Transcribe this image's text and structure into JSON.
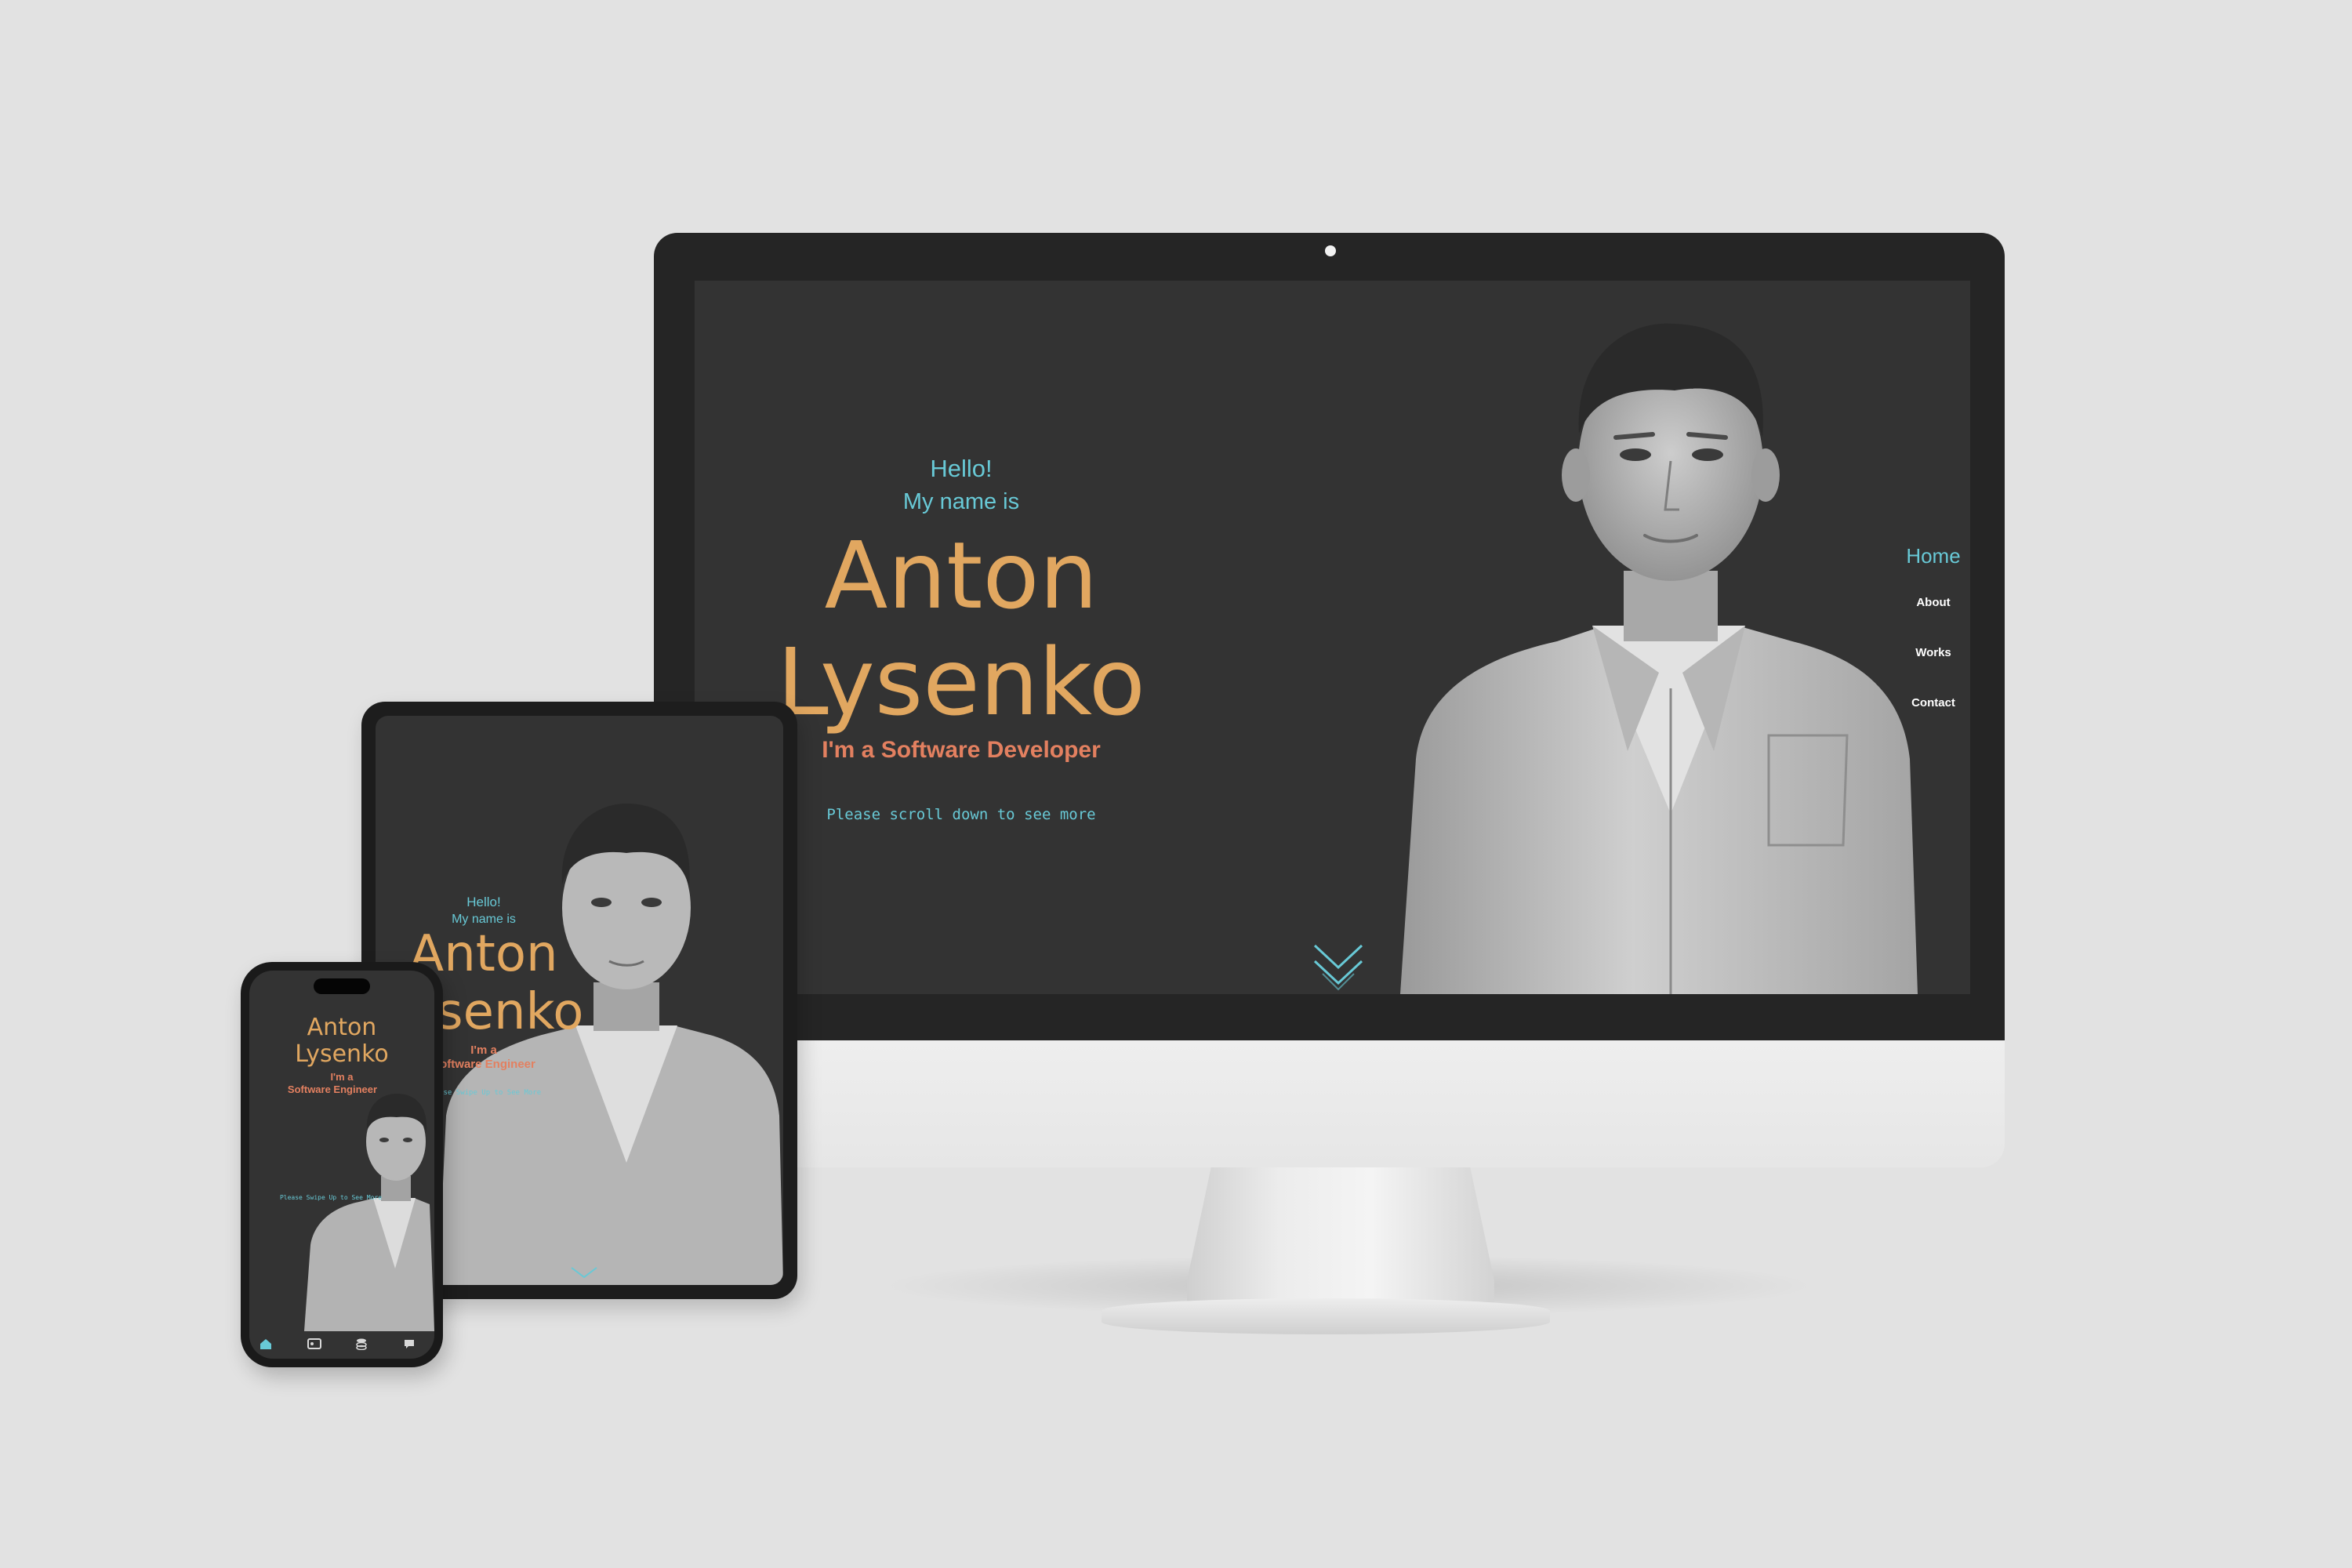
{
  "colors": {
    "background": "#e2e2e2",
    "screen_bg": "#333333",
    "accent_cyan": "#68c9d6",
    "name_gold": "#e1a760",
    "role_coral": "#e38060"
  },
  "desktop": {
    "greeting": "Hello!",
    "intro": "My name is",
    "first_name": "Anton",
    "last_name": "Lysenko",
    "role": "I'm a Software Developer",
    "scroll_hint": "Please scroll down to see more",
    "nav": {
      "active": "Home",
      "items": [
        "About",
        "Works",
        "Contact"
      ]
    },
    "scroll_icon": "double-chevron-down-icon"
  },
  "tablet": {
    "greeting": "Hello!",
    "intro": "My name is",
    "first_name": "Anton",
    "last_name": "Lysenko",
    "role_line1": "I'm a",
    "role_line2": "Software Engineer",
    "hint": "Please Swipe Up to See More"
  },
  "mobile": {
    "first_name": "Anton",
    "last_name": "Lysenko",
    "role_line1": "I'm a",
    "role_line2": "Software Engineer",
    "hint": "Please Swipe Up to See More",
    "tabbar_icons": [
      "home-icon",
      "id-card-icon",
      "stack-icon",
      "chat-icon"
    ]
  }
}
